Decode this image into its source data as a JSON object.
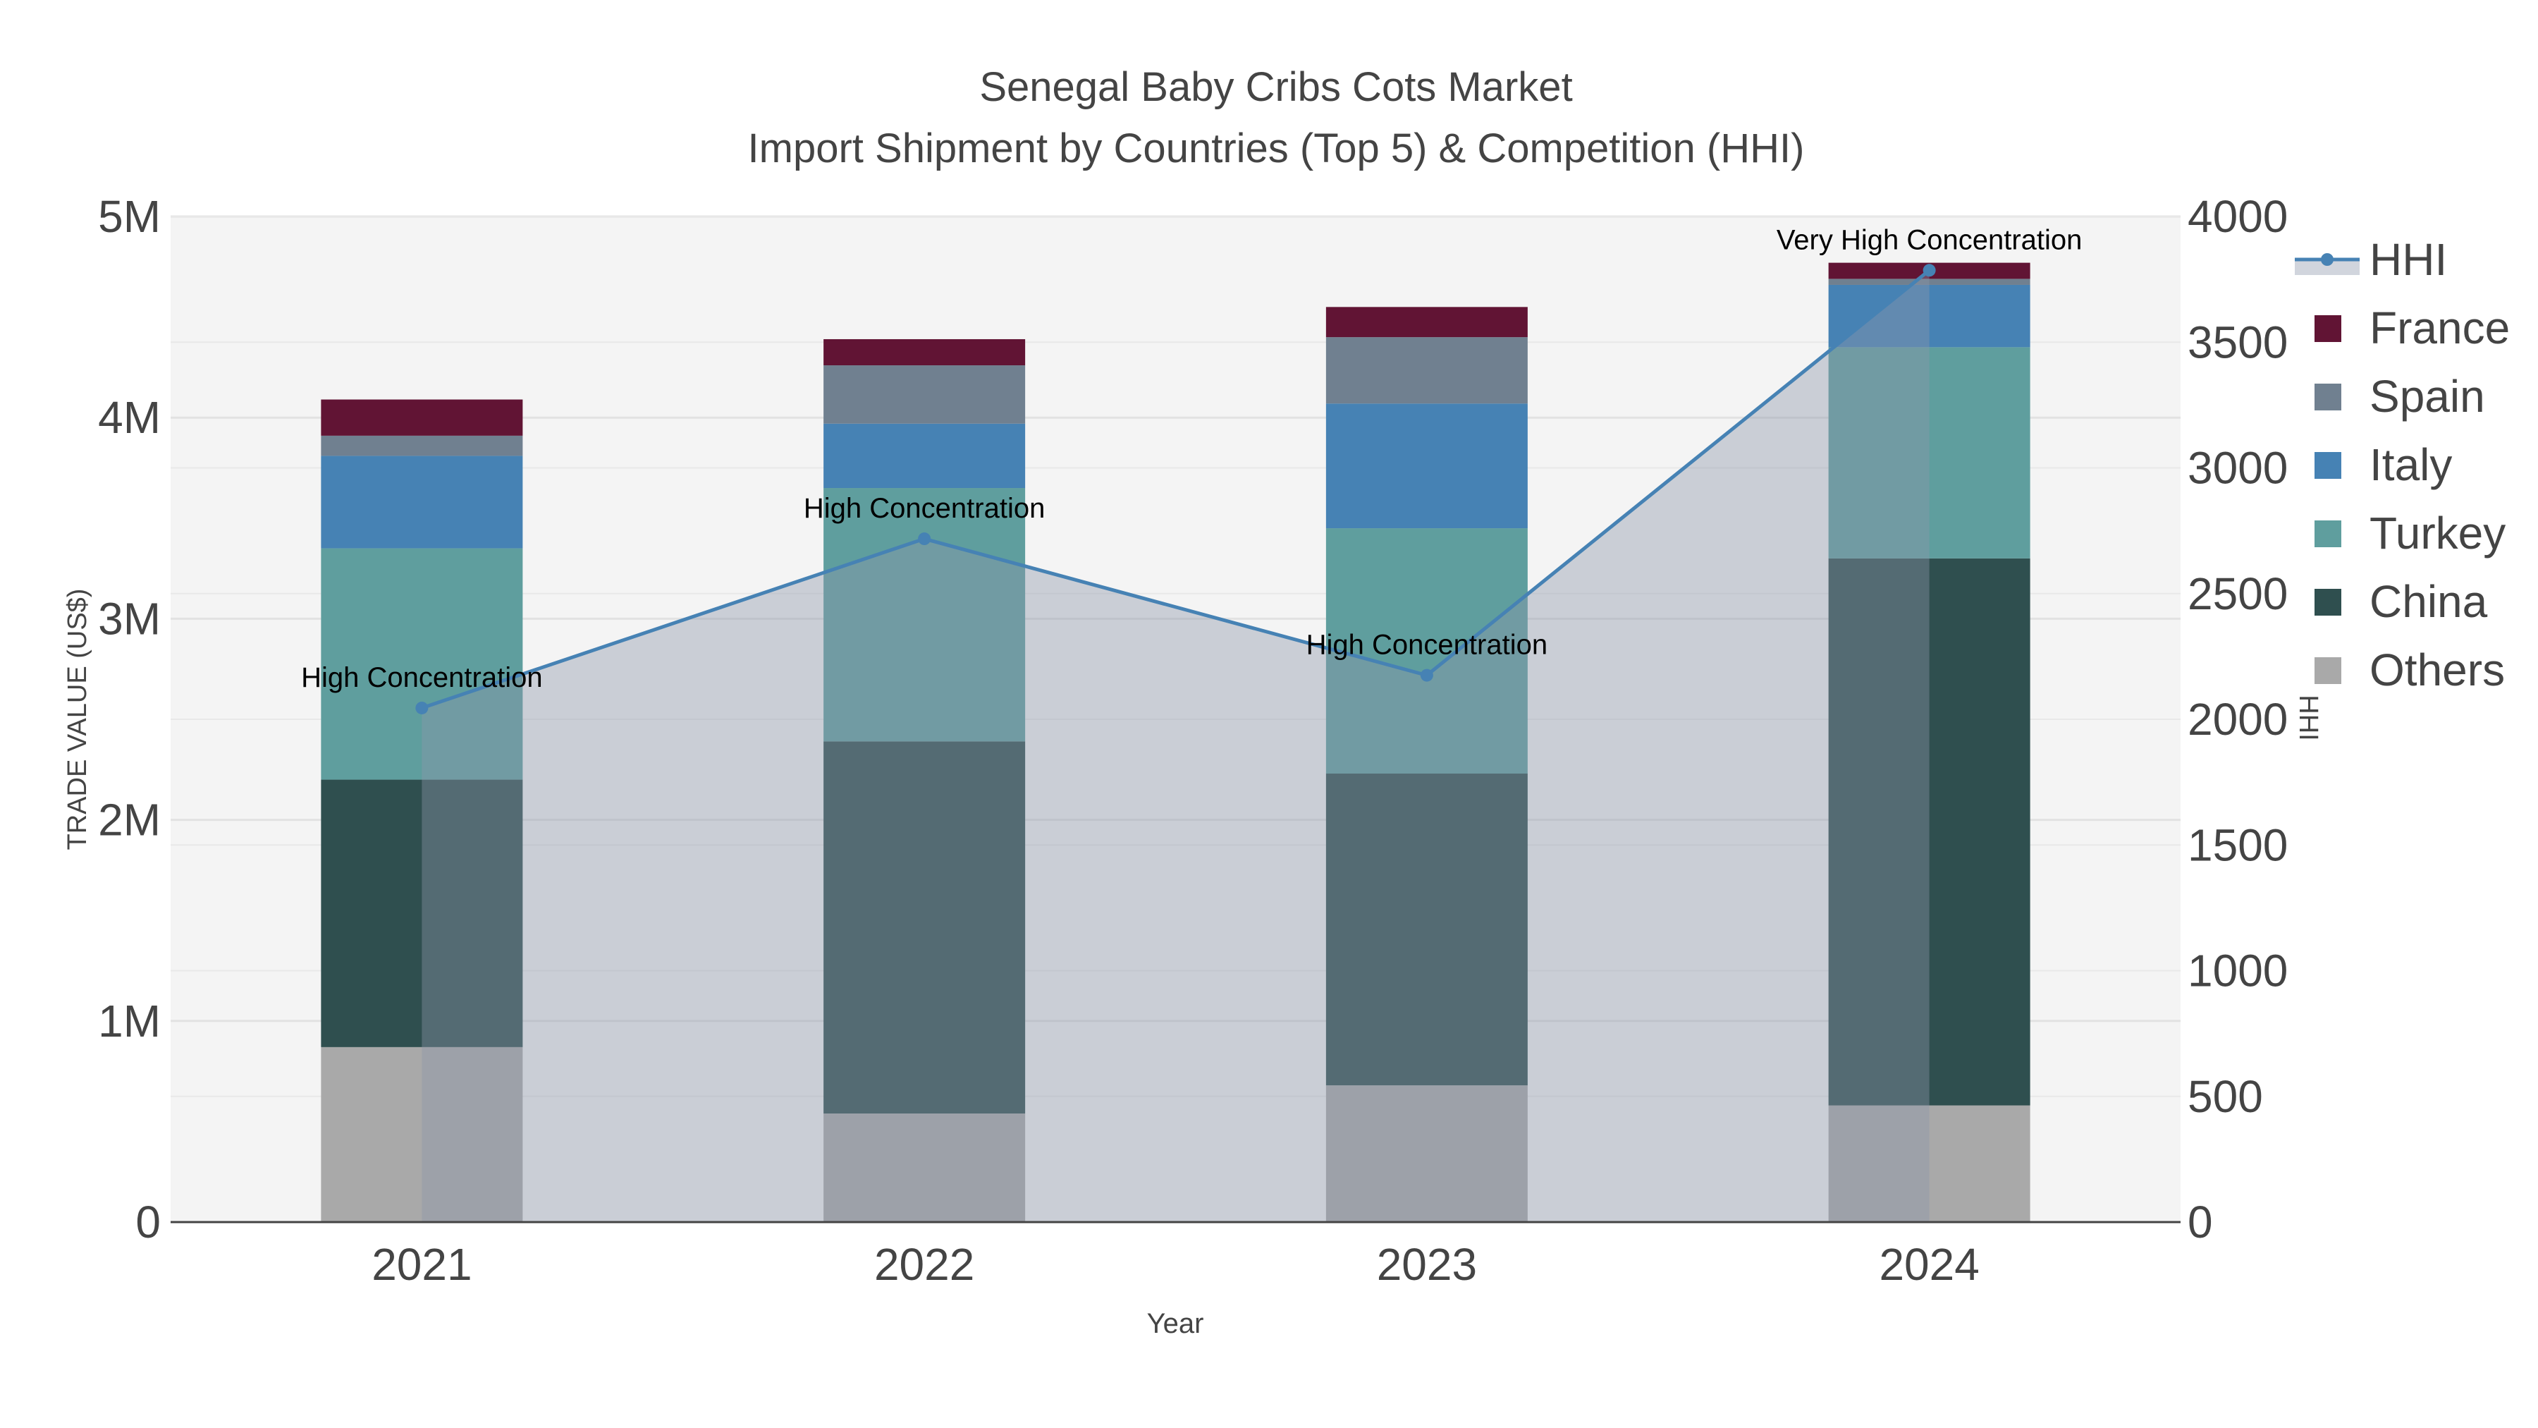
{
  "chart_data": {
    "type": "bar",
    "stacked": true,
    "title": "Senegal Baby Cribs Cots Market",
    "subtitle": "Import Shipment by Countries (Top 5) & Competition (HHI)",
    "xlabel": "Year",
    "ylabel": "TRADE VALUE (US$)",
    "y2label": "HHI",
    "categories": [
      "2021",
      "2022",
      "2023",
      "2024"
    ],
    "ylim": [
      0,
      5000000
    ],
    "yticks": [
      0,
      1000000,
      2000000,
      3000000,
      4000000,
      5000000
    ],
    "ytick_labels": [
      "0",
      "1M",
      "2M",
      "3M",
      "4M",
      "5M"
    ],
    "y2lim": [
      0,
      4000
    ],
    "y2ticks": [
      0,
      500,
      1000,
      1500,
      2000,
      2500,
      3000,
      3500,
      4000
    ],
    "y2tick_labels": [
      "0",
      "500",
      "1000",
      "1500",
      "2000",
      "2500",
      "3000",
      "3500",
      "4000"
    ],
    "grid": true,
    "legend_placement": "right",
    "series": [
      {
        "name": "Others",
        "color": "#a9a9a9",
        "values": [
          870000,
          540000,
          680000,
          580000
        ]
      },
      {
        "name": "China",
        "color": "#2f4f4f",
        "values": [
          1330000,
          1850000,
          1550000,
          2720000
        ]
      },
      {
        "name": "Turkey",
        "color": "#5f9e9e",
        "values": [
          1150000,
          1260000,
          1220000,
          1050000
        ]
      },
      {
        "name": "Italy",
        "color": "#4682b4",
        "values": [
          460000,
          320000,
          620000,
          310000
        ]
      },
      {
        "name": "Spain",
        "color": "#708090",
        "values": [
          100000,
          290000,
          330000,
          30000
        ]
      },
      {
        "name": "France",
        "color": "#611434",
        "values": [
          180000,
          130000,
          150000,
          80000
        ]
      }
    ],
    "line": {
      "name": "HHI",
      "color": "#4682b4",
      "axis": "y2",
      "fill": "tozeroy",
      "values": [
        2045,
        2718,
        2175,
        3786
      ],
      "annotations": [
        "High Concentration",
        "High Concentration",
        "High Concentration",
        "Very High Concentration"
      ]
    }
  }
}
